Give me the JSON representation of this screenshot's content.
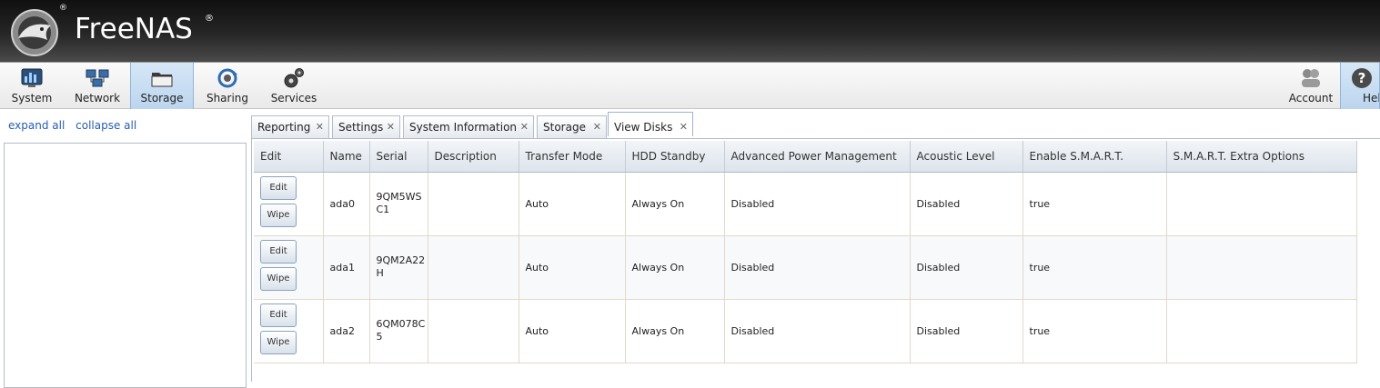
{
  "brand": {
    "name": "FreeNAS",
    "reg": "®"
  },
  "toolbar": {
    "items": [
      {
        "label": "System",
        "icon": "system-monitor-icon"
      },
      {
        "label": "Network",
        "icon": "network-computers-icon"
      },
      {
        "label": "Storage",
        "icon": "storage-folder-icon",
        "active": true
      },
      {
        "label": "Sharing",
        "icon": "sharing-arrows-icon"
      },
      {
        "label": "Services",
        "icon": "services-gears-icon"
      }
    ],
    "right_items": [
      {
        "label": "Account",
        "icon": "account-users-icon"
      },
      {
        "label": "Help",
        "icon": "help-question-icon"
      }
    ]
  },
  "tree": {
    "expand_all": "expand all",
    "collapse_all": "collapse all"
  },
  "tabs": [
    {
      "label": "Reporting"
    },
    {
      "label": "Settings"
    },
    {
      "label": "System Information"
    },
    {
      "label": "Storage"
    },
    {
      "label": "View Disks",
      "active": true
    }
  ],
  "table": {
    "columns": [
      "Edit",
      "Name",
      "Serial",
      "Description",
      "Transfer Mode",
      "HDD Standby",
      "Advanced Power Management",
      "Acoustic Level",
      "Enable S.M.A.R.T.",
      "S.M.A.R.T. Extra Options"
    ],
    "edit_label": "Edit",
    "wipe_label": "Wipe",
    "rows": [
      {
        "name": "ada0",
        "serial": "9QM5WSC1",
        "description": "",
        "transfer_mode": "Auto",
        "hdd_standby": "Always On",
        "apm": "Disabled",
        "acoustic": "Disabled",
        "smart": "true",
        "smart_extra": ""
      },
      {
        "name": "ada1",
        "serial": "9QM2A22H",
        "description": "",
        "transfer_mode": "Auto",
        "hdd_standby": "Always On",
        "apm": "Disabled",
        "acoustic": "Disabled",
        "smart": "true",
        "smart_extra": ""
      },
      {
        "name": "ada2",
        "serial": "6QM078C5",
        "description": "",
        "transfer_mode": "Auto",
        "hdd_standby": "Always On",
        "apm": "Disabled",
        "acoustic": "Disabled",
        "smart": "true",
        "smart_extra": ""
      }
    ]
  }
}
